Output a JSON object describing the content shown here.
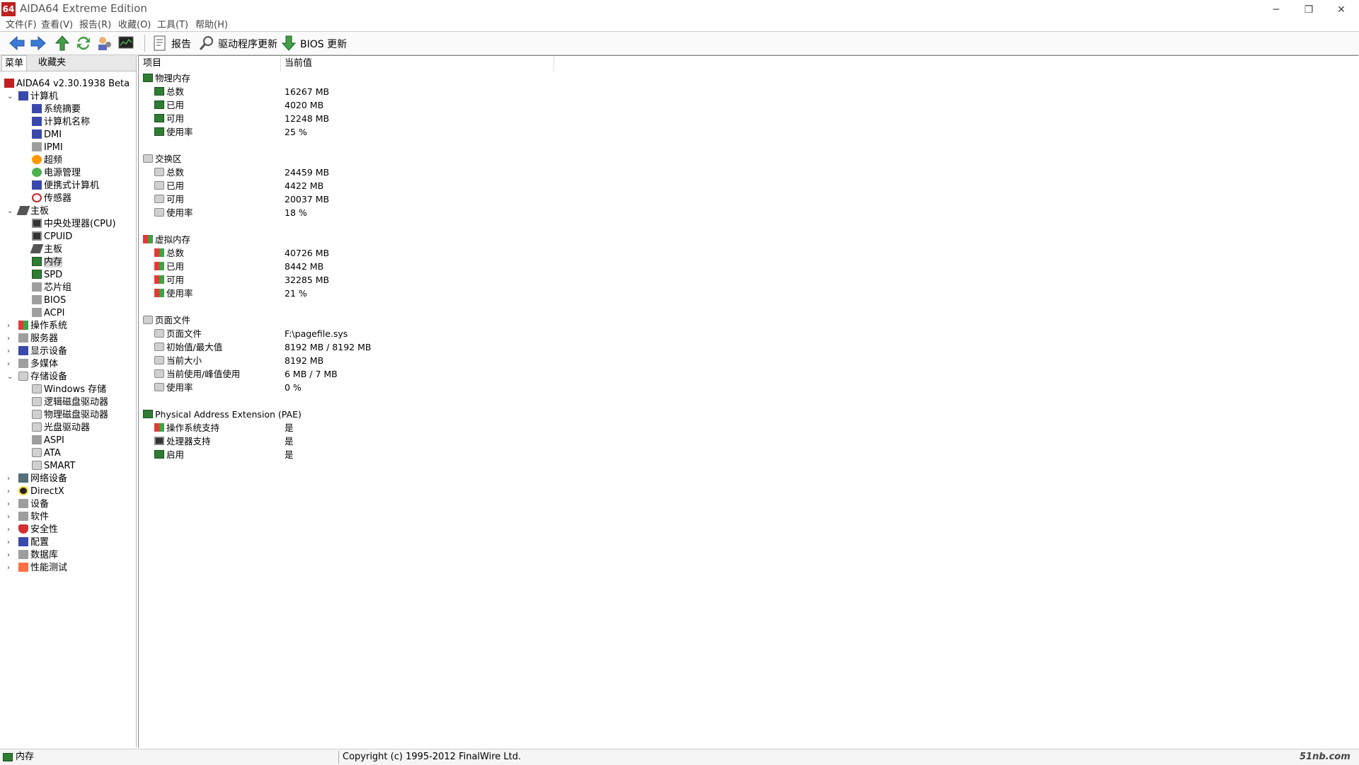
{
  "app": {
    "title": "AIDA64 Extreme Edition",
    "logo_text": "64",
    "window_controls": {
      "minimize": "─",
      "restore": "❐",
      "close": "✕"
    }
  },
  "menu": [
    "文件(F)",
    "查看(V)",
    "报告(R)",
    "收藏(O)",
    "工具(T)",
    "帮助(H)"
  ],
  "toolbar": {
    "report_label": "报告",
    "driver_update_label": "驱动程序更新",
    "bios_update_label": "BIOS 更新"
  },
  "left_tabs": {
    "menu": "菜单",
    "favorites": "收藏夹"
  },
  "tree": {
    "root": "AIDA64 v2.30.1938 Beta",
    "computer": {
      "label": "计算机",
      "children": [
        "系统摘要",
        "计算机名称",
        "DMI",
        "IPMI",
        "超频",
        "电源管理",
        "便携式计算机",
        "传感器"
      ]
    },
    "motherboard": {
      "label": "主板",
      "children": [
        "中央处理器(CPU)",
        "CPUID",
        "主板",
        "内存",
        "SPD",
        "芯片组",
        "BIOS",
        "ACPI"
      ]
    },
    "os": "操作系统",
    "server": "服务器",
    "display": "显示设备",
    "multimedia": "多媒体",
    "storage": {
      "label": "存储设备",
      "children": [
        "Windows 存储",
        "逻辑磁盘驱动器",
        "物理磁盘驱动器",
        "光盘驱动器",
        "ASPI",
        "ATA",
        "SMART"
      ]
    },
    "network": "网络设备",
    "directx": "DirectX",
    "devices": "设备",
    "software": "软件",
    "security": "安全性",
    "config": "配置",
    "database": "数据库",
    "benchmark": "性能测试"
  },
  "columns": {
    "item": "项目",
    "value": "当前值"
  },
  "sections": [
    {
      "title": "物理内存",
      "icon": "ram-icon",
      "rows": [
        {
          "label": "总数",
          "value": "16267 MB"
        },
        {
          "label": "已用",
          "value": "4020 MB"
        },
        {
          "label": "可用",
          "value": "12248 MB"
        },
        {
          "label": "使用率",
          "value": "25 %"
        }
      ]
    },
    {
      "title": "交换区",
      "icon": "disk-icon",
      "rows": [
        {
          "label": "总数",
          "value": "24459 MB"
        },
        {
          "label": "已用",
          "value": "4422 MB"
        },
        {
          "label": "可用",
          "value": "20037 MB"
        },
        {
          "label": "使用率",
          "value": "18 %"
        }
      ]
    },
    {
      "title": "虚拟内存",
      "icon": "windows-icon",
      "rows": [
        {
          "label": "总数",
          "value": "40726 MB"
        },
        {
          "label": "已用",
          "value": "8442 MB"
        },
        {
          "label": "可用",
          "value": "32285 MB"
        },
        {
          "label": "使用率",
          "value": "21 %"
        }
      ]
    },
    {
      "title": "页面文件",
      "icon": "disk-icon",
      "rows": [
        {
          "label": "页面文件",
          "value": "F:\\pagefile.sys"
        },
        {
          "label": "初始值/最大值",
          "value": "8192 MB / 8192 MB"
        },
        {
          "label": "当前大小",
          "value": "8192 MB"
        },
        {
          "label": "当前使用/峰值使用",
          "value": "6 MB / 7 MB"
        },
        {
          "label": "使用率",
          "value": "0 %"
        }
      ]
    },
    {
      "title": "Physical Address Extension (PAE)",
      "icon": "ram-icon",
      "rows": [
        {
          "label": "操作系统支持",
          "value": "是"
        },
        {
          "label": "处理器支持",
          "value": "是"
        },
        {
          "label": "启用",
          "value": "是"
        }
      ]
    }
  ],
  "status": {
    "left": "内存",
    "right": "Copyright (c) 1995-2012 FinalWire Ltd."
  },
  "watermark": "51nb.com"
}
